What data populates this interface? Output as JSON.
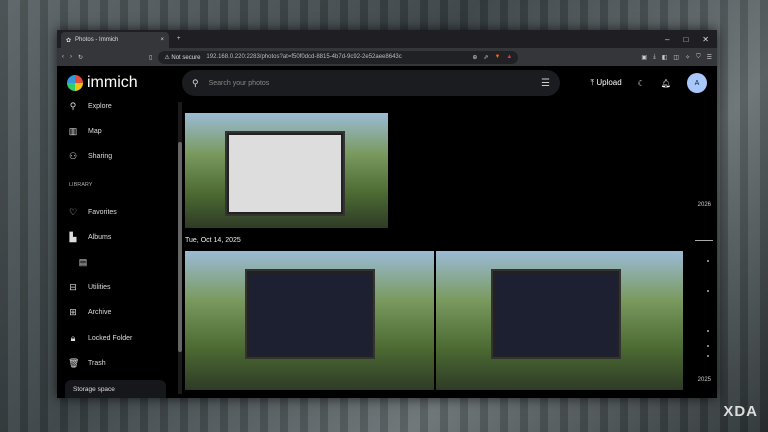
{
  "browser": {
    "tab_title": "Photos - Immich",
    "new_tab": "+",
    "url_warning": "Not secure",
    "url": "192.168.0.220:2283/photos?at=f50f0dcd-8815-4b7d-9c92-2e52aee8643c"
  },
  "header": {
    "app_name": "immich",
    "search_placeholder": "Search your photos",
    "upload_label": "Upload",
    "avatar_initial": "A"
  },
  "sidebar": {
    "items": [
      {
        "label": "Explore",
        "icon": "search-icon"
      },
      {
        "label": "Map",
        "icon": "map-icon"
      },
      {
        "label": "Sharing",
        "icon": "people-icon"
      }
    ],
    "library_label": "LIBRARY",
    "library_items": [
      {
        "label": "Favorites"
      },
      {
        "label": "Albums"
      },
      {
        "label": "Utilities"
      },
      {
        "label": "Archive"
      },
      {
        "label": "Locked Folder"
      },
      {
        "label": "Trash"
      }
    ],
    "storage_label": "Storage space"
  },
  "main": {
    "date_group": "Tue, Oct 14, 2025"
  },
  "timeline": {
    "year_top": "2026",
    "year_bottom": "2025"
  },
  "watermark": "XDA"
}
